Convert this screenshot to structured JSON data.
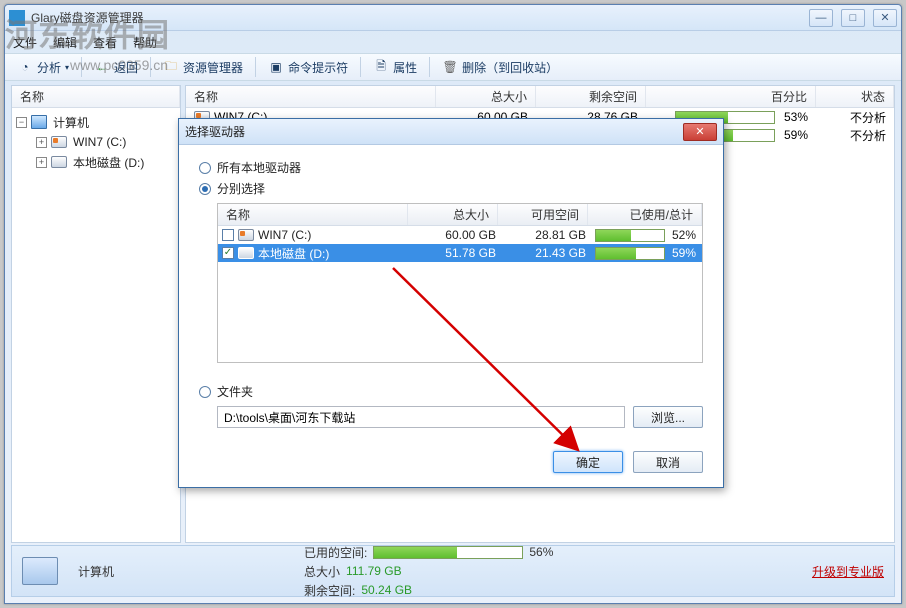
{
  "window": {
    "title": "Glary磁盘资源管理器",
    "menu": {
      "file": "文件",
      "edit": "编辑",
      "view": "查看",
      "help": "帮助"
    },
    "toolbar": {
      "analyze": "分析",
      "back": "返回",
      "explorer": "资源管理器",
      "cmd": "命令提示符",
      "properties": "属性",
      "delete": "删除（到回收站）"
    }
  },
  "watermark": {
    "main": "河东软件园",
    "sub": "www.pc0359.cn"
  },
  "left": {
    "header": "名称",
    "root": "计算机",
    "drives": [
      {
        "label": "WIN7 (C:)"
      },
      {
        "label": "本地磁盘 (D:)"
      }
    ]
  },
  "right": {
    "headers": {
      "name": "名称",
      "total": "总大小",
      "free": "剩余空间",
      "percent": "百分比",
      "status": "状态"
    },
    "rows": [
      {
        "name": "WIN7 (C:)",
        "total": "60.00 GB",
        "free": "28.76 GB",
        "percent_text": "53%",
        "fill": 53,
        "status": "不分析"
      },
      {
        "name": "",
        "total": "",
        "free": "",
        "percent_text": "59%",
        "fill": 59,
        "status": "不分析"
      }
    ]
  },
  "dialog": {
    "title": "选择驱动器",
    "opt_all": "所有本地驱动器",
    "opt_select": "分别选择",
    "headers": {
      "name": "名称",
      "total": "总大小",
      "avail": "可用空间",
      "used_total": "已使用/总计"
    },
    "rows": [
      {
        "checked": false,
        "name": "WIN7 (C:)",
        "total": "60.00 GB",
        "avail": "28.81 GB",
        "fill": 52,
        "percent": "52%",
        "selected": false
      },
      {
        "checked": true,
        "name": "本地磁盘 (D:)",
        "total": "51.78 GB",
        "avail": "21.43 GB",
        "fill": 59,
        "percent": "59%",
        "selected": true
      }
    ],
    "opt_folder": "文件夹",
    "path": "D:\\tools\\桌面\\河东下载站",
    "browse": "浏览...",
    "ok": "确定",
    "cancel": "取消"
  },
  "status": {
    "name": "计算机",
    "used_label": "已用的空间:",
    "used_percent": "56%",
    "used_fill": 56,
    "total_label": "总大小",
    "total_value": "111.79 GB",
    "free_label": "剩余空间:",
    "free_value": "50.24 GB",
    "upgrade": "升级到专业版"
  }
}
